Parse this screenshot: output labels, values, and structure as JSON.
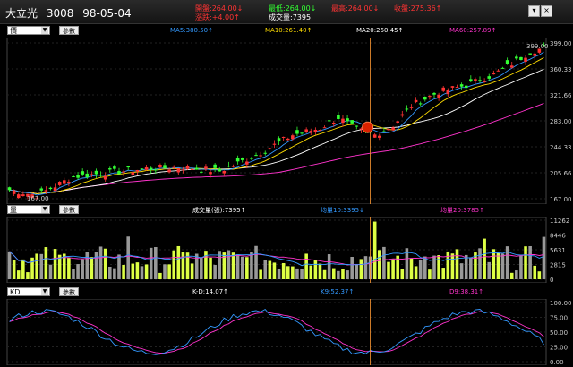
{
  "header": {
    "name": "大立光",
    "code": "3008",
    "date": "98-05-04",
    "quotes": [
      {
        "text": "開盤:264.00↓",
        "color": "#ff3333"
      },
      {
        "text": "最高:264.00↓",
        "color": "#ff3333"
      },
      {
        "text": "最低:264.00↓",
        "color": "#33ff33"
      },
      {
        "text": "收盤:275.36↑",
        "color": "#ff3333"
      },
      {
        "text": "漲跌:+4.00↑",
        "color": "#ff3333"
      },
      {
        "text": "成交量:7395",
        "color": "#ffffff"
      }
    ],
    "minimize": "▾",
    "close": "×"
  },
  "price_panel": {
    "select": "價",
    "params_button": "參數",
    "ma_labels": [
      {
        "text": "MA5:380.50↑",
        "color": "#3399ff"
      },
      {
        "text": "MA10:261.40↑",
        "color": "#ffdd00"
      },
      {
        "text": "MA20:260.45↑",
        "color": "#ffffff"
      },
      {
        "text": "MA60:257.89↑",
        "color": "#ff33cc"
      }
    ],
    "y_ticks": [
      "399.00",
      "360.33",
      "321.66",
      "283.00",
      "244.33",
      "205.66",
      "167.00"
    ],
    "low_label": "167.00",
    "high_label": "399.00"
  },
  "volume_panel": {
    "select": "量",
    "params_button": "參數",
    "labels": [
      {
        "text": "成交量(張):7395↑",
        "color": "#ffffff"
      },
      {
        "text": "均量10:3395↓",
        "color": "#3399ff"
      },
      {
        "text": "均量20:3785↑",
        "color": "#ff33cc"
      }
    ],
    "y_ticks": [
      "11262",
      "8446",
      "5631",
      "2815",
      "0"
    ]
  },
  "kd_panel": {
    "select": "KD",
    "params_button": "參數",
    "labels": [
      {
        "text": "K-D:14.07↑",
        "color": "#ffffff"
      },
      {
        "text": "K9:52.37↑",
        "color": "#3399ff"
      },
      {
        "text": "D9:38.31↑",
        "color": "#ff33cc"
      }
    ],
    "y_ticks": [
      "100.00",
      "75.00",
      "50.00",
      "25.00",
      "0.00"
    ]
  },
  "colors": {
    "up": "#ff3333",
    "down": "#33ff33",
    "vol_up": "#ddff44",
    "vol_down": "#999999",
    "ma5": "#3399ff",
    "ma10": "#ffdd00",
    "ma20": "#ffffff",
    "ma60": "#ff33cc",
    "cursor": "#ff9933"
  }
}
